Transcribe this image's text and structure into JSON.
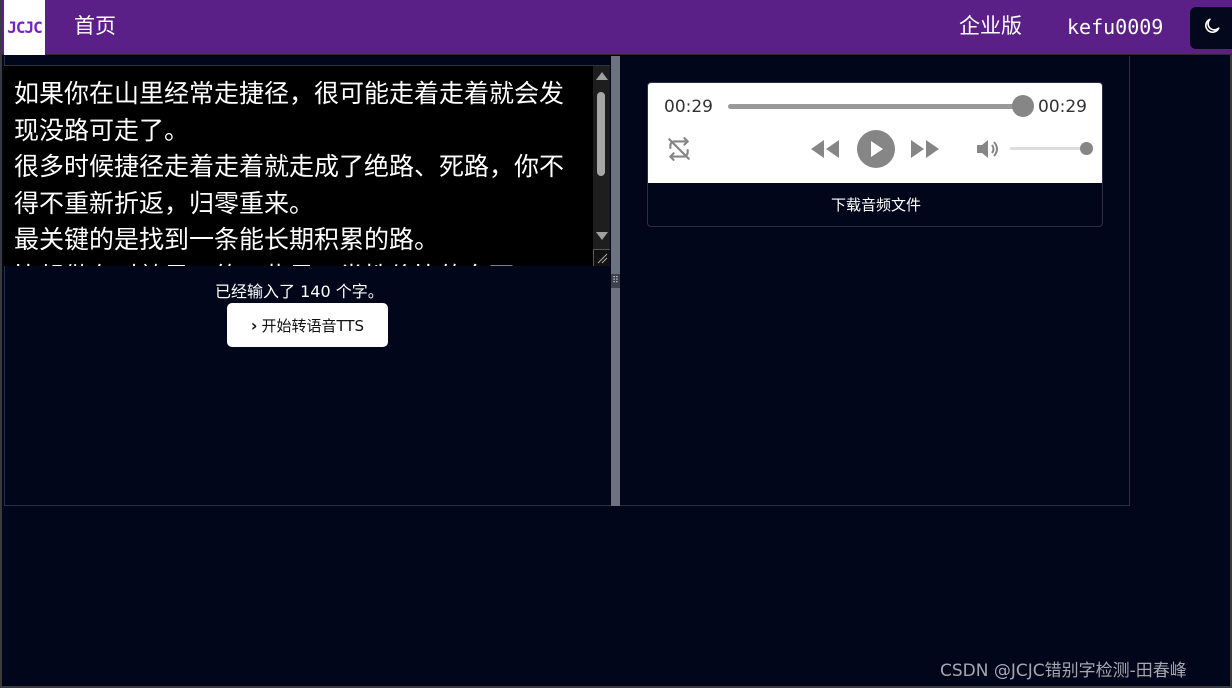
{
  "header": {
    "logo_text": "JCJC",
    "nav_home": "首页",
    "enterprise_label": "企业版",
    "username": "kefu0009",
    "theme_toggle_icon": "moon-icon",
    "background_color": "#5b1f88"
  },
  "editor": {
    "text": "如果你在山里经常走捷径，很可能走着走着就会发现没路可走了。\n很多时候捷径走着走着就走成了绝路、死路，你不得不重新折返，归零重来。\n最关键的是找到一条能长期积累的路。\n比起做有时效风口的一些风口类性价比的东西",
    "char_count_text": "已经输入了 140 个字。",
    "tts_button_label": "开始转语音TTS"
  },
  "player": {
    "current_time": "00:29",
    "total_time": "00:29",
    "progress": 1.0,
    "volume": 1.0,
    "download_label": "下载音频文件"
  },
  "footer": {
    "watermark": "CSDN @JCJC错别字检测-田春峰"
  },
  "colors": {
    "page_background": "#02061a",
    "splitter": "#6b7280",
    "control_gray": "#868686"
  }
}
